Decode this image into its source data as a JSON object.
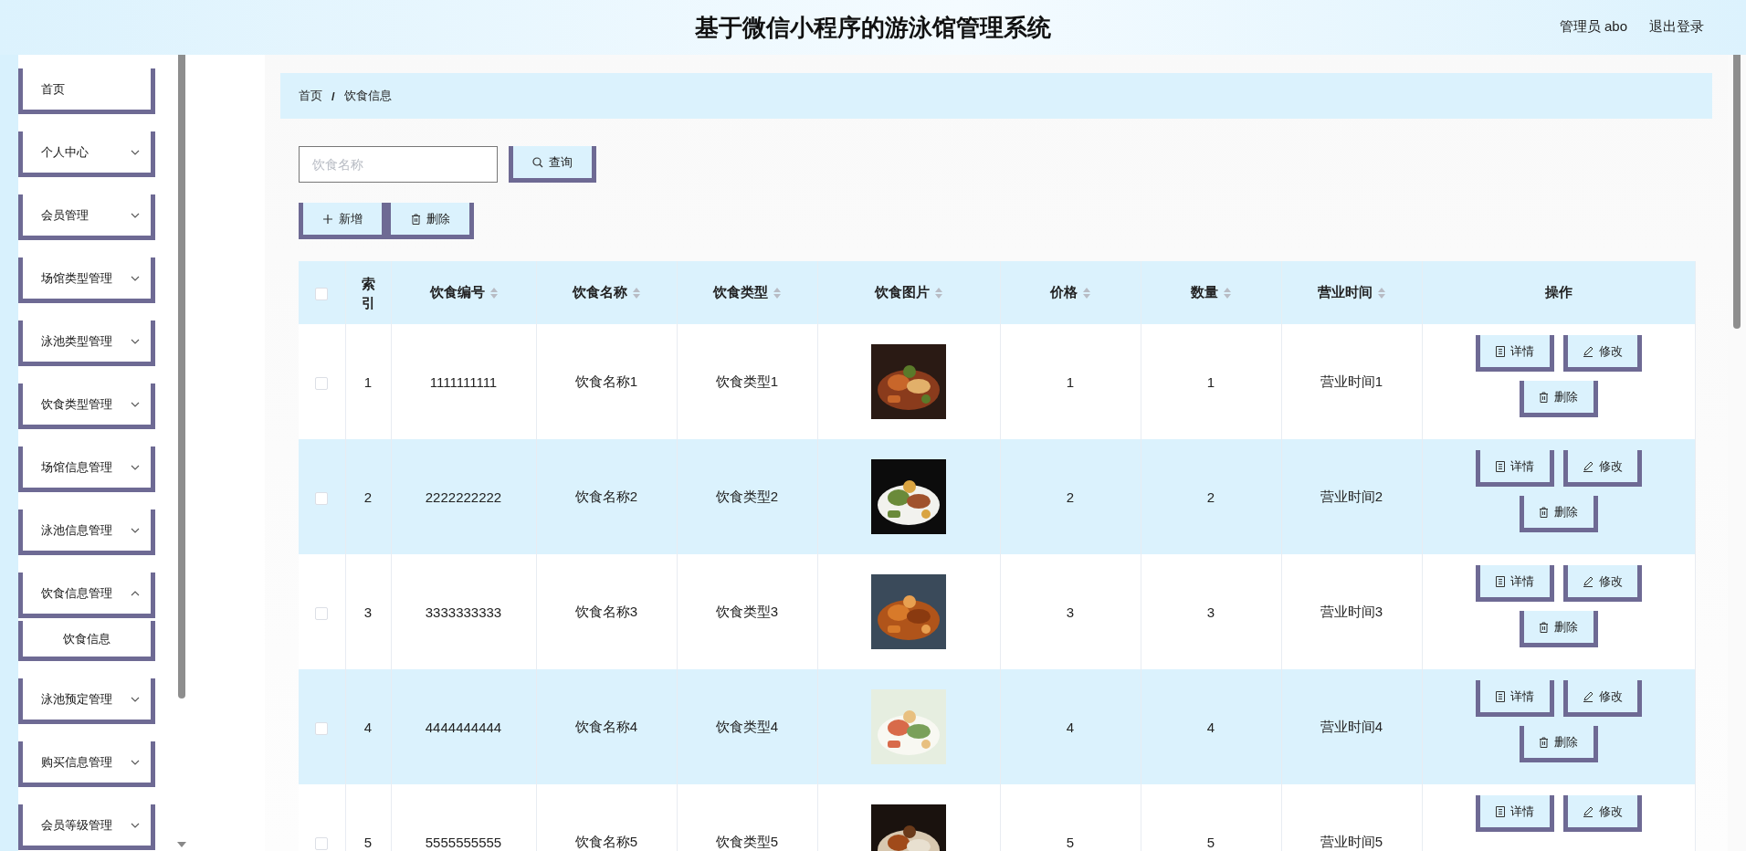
{
  "header": {
    "title": "基于微信小程序的游泳馆管理系统",
    "user": "管理员 abo",
    "logout": "退出登录"
  },
  "sidebar": {
    "items": [
      {
        "label": "首页"
      },
      {
        "label": "个人中心",
        "expandable": true,
        "expanded": false
      },
      {
        "label": "会员管理",
        "expandable": true,
        "expanded": false
      },
      {
        "label": "场馆类型管理",
        "expandable": true,
        "expanded": false
      },
      {
        "label": "泳池类型管理",
        "expandable": true,
        "expanded": false
      },
      {
        "label": "饮食类型管理",
        "expandable": true,
        "expanded": false
      },
      {
        "label": "场馆信息管理",
        "expandable": true,
        "expanded": false
      },
      {
        "label": "泳池信息管理",
        "expandable": true,
        "expanded": false
      },
      {
        "label": "饮食信息管理",
        "expandable": true,
        "expanded": true,
        "children": [
          {
            "label": "饮食信息"
          }
        ]
      },
      {
        "label": "泳池预定管理",
        "expandable": true,
        "expanded": false
      },
      {
        "label": "购买信息管理",
        "expandable": true,
        "expanded": false
      },
      {
        "label": "会员等级管理",
        "expandable": true,
        "expanded": false
      }
    ]
  },
  "breadcrumb": [
    "首页",
    "饮食信息"
  ],
  "breadcrumb_separator": "/",
  "search": {
    "placeholder": "饮食名称",
    "button": "查询"
  },
  "toolbar": [
    {
      "label": "新增",
      "kind": "add"
    },
    {
      "label": "删除",
      "kind": "delete"
    }
  ],
  "table": {
    "select_all_checked": false,
    "columns": [
      {
        "label": "索引",
        "sortable": false
      },
      {
        "label": "饮食编号",
        "sortable": true
      },
      {
        "label": "饮食名称",
        "sortable": true
      },
      {
        "label": "饮食类型",
        "sortable": true
      },
      {
        "label": "饮食图片",
        "sortable": true
      },
      {
        "label": "价格",
        "sortable": true
      },
      {
        "label": "数量",
        "sortable": true
      },
      {
        "label": "营业时间",
        "sortable": true
      },
      {
        "label": "操作",
        "sortable": false
      }
    ],
    "rows": [
      {
        "checked": false,
        "index": "1",
        "code": "1111111111",
        "name": "饮食名称1",
        "type": "饮食类型1",
        "image": {
          "kind": "picture"
        },
        "price": "1",
        "qty": "1",
        "hours": "营业时间1",
        "actions": [
          {
            "label": "详情",
            "kind": "detail"
          },
          {
            "label": "修改",
            "kind": "edit"
          },
          {
            "label": "删除",
            "kind": "delete"
          }
        ]
      },
      {
        "checked": false,
        "index": "2",
        "code": "2222222222",
        "name": "饮食名称2",
        "type": "饮食类型2",
        "image": {
          "kind": "picture"
        },
        "price": "2",
        "qty": "2",
        "hours": "营业时间2",
        "actions": [
          {
            "label": "详情",
            "kind": "detail"
          },
          {
            "label": "修改",
            "kind": "edit"
          },
          {
            "label": "删除",
            "kind": "delete"
          }
        ]
      },
      {
        "checked": false,
        "index": "3",
        "code": "3333333333",
        "name": "饮食名称3",
        "type": "饮食类型3",
        "image": {
          "kind": "picture"
        },
        "price": "3",
        "qty": "3",
        "hours": "营业时间3",
        "actions": [
          {
            "label": "详情",
            "kind": "detail"
          },
          {
            "label": "修改",
            "kind": "edit"
          },
          {
            "label": "删除",
            "kind": "delete"
          }
        ]
      },
      {
        "checked": false,
        "index": "4",
        "code": "4444444444",
        "name": "饮食名称4",
        "type": "饮食类型4",
        "image": {
          "kind": "picture"
        },
        "price": "4",
        "qty": "4",
        "hours": "营业时间4",
        "actions": [
          {
            "label": "详情",
            "kind": "detail"
          },
          {
            "label": "修改",
            "kind": "edit"
          },
          {
            "label": "删除",
            "kind": "delete"
          }
        ]
      },
      {
        "checked": false,
        "index": "5",
        "code": "5555555555",
        "name": "饮食名称5",
        "type": "饮食类型5",
        "image": {
          "kind": "picture"
        },
        "price": "5",
        "qty": "5",
        "hours": "营业时间5",
        "actions": [
          {
            "label": "详情",
            "kind": "detail"
          },
          {
            "label": "修改",
            "kind": "edit"
          }
        ]
      }
    ]
  }
}
